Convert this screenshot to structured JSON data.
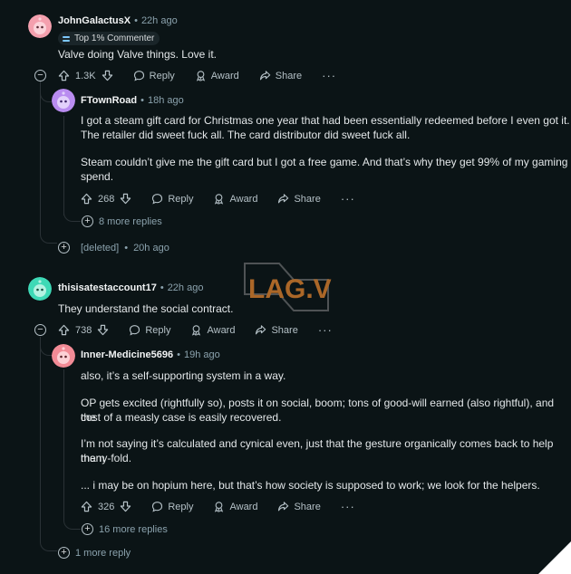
{
  "comments": [
    {
      "username": "JohnGalactusX",
      "time": "22h ago",
      "badge": "Top 1% Commenter",
      "text": "Valve doing Valve things. Love it.",
      "votes": "1.3K",
      "avatar_color": "#f4a0ae",
      "replies": [
        {
          "username": "FTownRoad",
          "time": "18h ago",
          "text_lines": [
            "I got a steam gift card for Christmas one year that had been essentially redeemed before I even got it.",
            "The retailer did sweet fuck all. The card distributor did sweet fuck all."
          ],
          "text2_lines": [
            "Steam couldn’t give me the gift card but I got a free game. And that’s why they get 99% of my gaming",
            "spend."
          ],
          "votes": "268",
          "avatar_color": "#b98cf0",
          "more_replies": "8 more replies"
        }
      ],
      "deleted": {
        "label": "[deleted]",
        "time": "20h ago"
      }
    },
    {
      "username": "thisisatestaccount17",
      "time": "22h ago",
      "text": "They understand the social contract.",
      "votes": "738",
      "avatar_color": "#3ed9b6",
      "replies": [
        {
          "username": "Inner-Medicine5696",
          "time": "19h ago",
          "p1": "also, it’s a self-supporting system in a way.",
          "p2_lines": [
            "OP gets excited (rightfully so), posts it on social, boom; tons of good-will earned (also rightful), and the",
            "cost of a measly case is easily recovered."
          ],
          "p3_lines": [
            "I’m not saying it’s calculated and cynical even, just that the gesture organically comes back to help them",
            "many-fold."
          ],
          "p4": "... i may be on hopium here, but that’s how society is supposed to work; we look for the helpers.",
          "votes": "326",
          "avatar_color": "#f28b96",
          "more_replies": "16 more replies"
        }
      ],
      "more_replies": "1 more reply"
    }
  ],
  "labels": {
    "reply": "Reply",
    "award": "Award",
    "share": "Share",
    "more": "···",
    "sep": "•"
  },
  "watermark": "LAG.VN"
}
